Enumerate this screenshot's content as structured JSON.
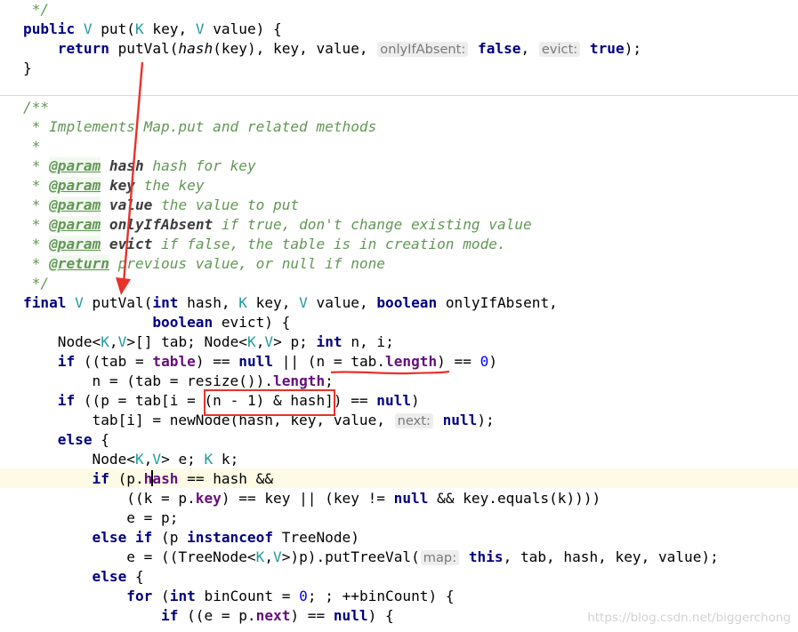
{
  "code_lines": [
    {
      "segs": [
        {
          "t": " */",
          "c": "doc"
        }
      ]
    },
    {
      "segs": [
        {
          "t": "public",
          "c": "kw"
        },
        {
          "t": " "
        },
        {
          "t": "V",
          "c": "typ"
        },
        {
          "t": " put("
        },
        {
          "t": "K",
          "c": "typ"
        },
        {
          "t": " key, "
        },
        {
          "t": "V",
          "c": "typ"
        },
        {
          "t": " value) {"
        }
      ]
    },
    {
      "segs": [
        {
          "t": "    "
        },
        {
          "t": "return",
          "c": "kw"
        },
        {
          "t": " putVal("
        },
        {
          "t": "hash",
          "c": "ital"
        },
        {
          "t": "(key), key, value, "
        },
        {
          "t": "onlyIfAbsent:",
          "c": "hint"
        },
        {
          "t": " "
        },
        {
          "t": "false",
          "c": "kw"
        },
        {
          "t": ", "
        },
        {
          "t": "evict:",
          "c": "hint"
        },
        {
          "t": " "
        },
        {
          "t": "true",
          "c": "kw"
        },
        {
          "t": ");"
        }
      ]
    },
    {
      "segs": [
        {
          "t": "}"
        }
      ]
    },
    {
      "segs": []
    },
    {
      "segs": [
        {
          "t": "/**",
          "c": "doc"
        }
      ]
    },
    {
      "segs": [
        {
          "t": " * Implements Map.put and related methods",
          "c": "doc"
        }
      ]
    },
    {
      "segs": [
        {
          "t": " *",
          "c": "doc"
        }
      ]
    },
    {
      "segs": [
        {
          "t": " * ",
          "c": "doc"
        },
        {
          "t": "@param",
          "c": "tag"
        },
        {
          "t": " "
        },
        {
          "t": "hash",
          "c": "tagp"
        },
        {
          "t": " hash for key",
          "c": "doc"
        }
      ]
    },
    {
      "segs": [
        {
          "t": " * ",
          "c": "doc"
        },
        {
          "t": "@param",
          "c": "tag"
        },
        {
          "t": " "
        },
        {
          "t": "key",
          "c": "tagp"
        },
        {
          "t": " the key",
          "c": "doc"
        }
      ]
    },
    {
      "segs": [
        {
          "t": " * ",
          "c": "doc"
        },
        {
          "t": "@param",
          "c": "tag"
        },
        {
          "t": " "
        },
        {
          "t": "value",
          "c": "tagp"
        },
        {
          "t": " the value to put",
          "c": "doc"
        }
      ]
    },
    {
      "segs": [
        {
          "t": " * ",
          "c": "doc"
        },
        {
          "t": "@param",
          "c": "tag"
        },
        {
          "t": " "
        },
        {
          "t": "onlyIfAbsent",
          "c": "tagp"
        },
        {
          "t": " if true, don't change existing value",
          "c": "doc"
        }
      ]
    },
    {
      "segs": [
        {
          "t": " * ",
          "c": "doc"
        },
        {
          "t": "@param",
          "c": "tag"
        },
        {
          "t": " "
        },
        {
          "t": "evict",
          "c": "tagp"
        },
        {
          "t": " if false, the table is in creation mode.",
          "c": "doc"
        }
      ]
    },
    {
      "segs": [
        {
          "t": " * ",
          "c": "doc"
        },
        {
          "t": "@return",
          "c": "tag"
        },
        {
          "t": " previous value, or null if none",
          "c": "doc"
        }
      ]
    },
    {
      "segs": [
        {
          "t": " */",
          "c": "doc"
        }
      ]
    },
    {
      "segs": [
        {
          "t": "final",
          "c": "kw"
        },
        {
          "t": " "
        },
        {
          "t": "V",
          "c": "typ"
        },
        {
          "t": " putVal("
        },
        {
          "t": "int",
          "c": "kw"
        },
        {
          "t": " hash, "
        },
        {
          "t": "K",
          "c": "typ"
        },
        {
          "t": " key, "
        },
        {
          "t": "V",
          "c": "typ"
        },
        {
          "t": " value, "
        },
        {
          "t": "boolean",
          "c": "kw"
        },
        {
          "t": " onlyIfAbsent,"
        }
      ]
    },
    {
      "segs": [
        {
          "t": "               "
        },
        {
          "t": "boolean",
          "c": "kw"
        },
        {
          "t": " evict) {"
        }
      ]
    },
    {
      "segs": [
        {
          "t": "    Node<"
        },
        {
          "t": "K",
          "c": "typ"
        },
        {
          "t": ","
        },
        {
          "t": "V",
          "c": "typ"
        },
        {
          "t": ">[] tab; Node<"
        },
        {
          "t": "K",
          "c": "typ"
        },
        {
          "t": ","
        },
        {
          "t": "V",
          "c": "typ"
        },
        {
          "t": "> p; "
        },
        {
          "t": "int",
          "c": "kw"
        },
        {
          "t": " n, i;"
        }
      ]
    },
    {
      "segs": [
        {
          "t": "    "
        },
        {
          "t": "if",
          "c": "kw"
        },
        {
          "t": " ((tab = "
        },
        {
          "t": "table",
          "c": "fld"
        },
        {
          "t": ") == "
        },
        {
          "t": "null",
          "c": "kw"
        },
        {
          "t": " || (n = tab."
        },
        {
          "t": "length",
          "c": "fld"
        },
        {
          "t": ") == "
        },
        {
          "t": "0",
          "c": "num"
        },
        {
          "t": ")"
        }
      ]
    },
    {
      "segs": [
        {
          "t": "        n = (tab = resize())."
        },
        {
          "t": "length",
          "c": "fld"
        },
        {
          "t": ";"
        }
      ]
    },
    {
      "segs": [
        {
          "t": "    "
        },
        {
          "t": "if",
          "c": "kw"
        },
        {
          "t": " ((p = tab[i = (n - 1) & hash]) == "
        },
        {
          "t": "null",
          "c": "kw"
        },
        {
          "t": ")"
        }
      ]
    },
    {
      "segs": [
        {
          "t": "        tab[i] = newNode(hash, key, value, "
        },
        {
          "t": "next:",
          "c": "hint"
        },
        {
          "t": " "
        },
        {
          "t": "null",
          "c": "kw"
        },
        {
          "t": ");"
        }
      ]
    },
    {
      "segs": [
        {
          "t": "    "
        },
        {
          "t": "else",
          "c": "kw"
        },
        {
          "t": " {"
        }
      ]
    },
    {
      "segs": [
        {
          "t": "        Node<"
        },
        {
          "t": "K",
          "c": "typ"
        },
        {
          "t": ","
        },
        {
          "t": "V",
          "c": "typ"
        },
        {
          "t": "> e; "
        },
        {
          "t": "K",
          "c": "typ"
        },
        {
          "t": " k;"
        }
      ]
    },
    {
      "segs": [
        {
          "t": "        "
        },
        {
          "t": "if",
          "c": "kw"
        },
        {
          "t": " (p."
        },
        {
          "t": "h",
          "c": "fld"
        },
        {
          "t": "|",
          "c": "caret"
        },
        {
          "t": "ash",
          "c": "fld"
        },
        {
          "t": " == hash &&"
        }
      ]
    },
    {
      "segs": [
        {
          "t": "            ((k = p."
        },
        {
          "t": "key",
          "c": "fld"
        },
        {
          "t": ") == key || (key != "
        },
        {
          "t": "null",
          "c": "kw"
        },
        {
          "t": " && key.equals(k))))"
        }
      ]
    },
    {
      "segs": [
        {
          "t": "            e = p;"
        }
      ]
    },
    {
      "segs": [
        {
          "t": "        "
        },
        {
          "t": "else if",
          "c": "kw"
        },
        {
          "t": " (p "
        },
        {
          "t": "instanceof",
          "c": "kw"
        },
        {
          "t": " TreeNode)"
        }
      ]
    },
    {
      "segs": [
        {
          "t": "            e = ((TreeNode<"
        },
        {
          "t": "K",
          "c": "typ"
        },
        {
          "t": ","
        },
        {
          "t": "V",
          "c": "typ"
        },
        {
          "t": ">)p).putTreeVal("
        },
        {
          "t": "map:",
          "c": "hint"
        },
        {
          "t": " "
        },
        {
          "t": "this",
          "c": "kw"
        },
        {
          "t": ", tab, hash, key, value);"
        }
      ]
    },
    {
      "segs": [
        {
          "t": "        "
        },
        {
          "t": "else",
          "c": "kw"
        },
        {
          "t": " {"
        }
      ]
    },
    {
      "segs": [
        {
          "t": "            "
        },
        {
          "t": "for",
          "c": "kw"
        },
        {
          "t": " ("
        },
        {
          "t": "int",
          "c": "kw"
        },
        {
          "t": " binCount = "
        },
        {
          "t": "0",
          "c": "num"
        },
        {
          "t": "; ; ++binCount) {"
        }
      ]
    },
    {
      "segs": [
        {
          "t": "                "
        },
        {
          "t": "if",
          "c": "kw"
        },
        {
          "t": " ((e = p."
        },
        {
          "t": "next",
          "c": "fld"
        },
        {
          "t": ") == "
        },
        {
          "t": "null",
          "c": "kw"
        },
        {
          "t": ") {"
        }
      ]
    }
  ],
  "watermark": "https://blog.csdn.net/biggerchong",
  "annotation_color": "#e8322b"
}
